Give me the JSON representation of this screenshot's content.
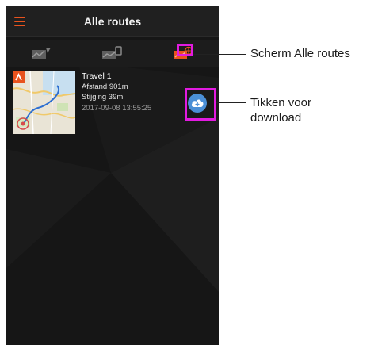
{
  "app": {
    "title": "Alle routes"
  },
  "tabs": [
    {
      "icon": "route-chart-icon",
      "active": false
    },
    {
      "icon": "route-device-icon",
      "active": false
    },
    {
      "icon": "route-online-icon",
      "active": true
    }
  ],
  "route": {
    "name": "Travel 1",
    "distance": "Afstand  901m",
    "climb": "Stijging  39m",
    "date": "2017-09-08 13:55:25"
  },
  "annotations": {
    "screen_label": "Scherm Alle routes",
    "download_line1": "Tikken voor",
    "download_line2": "download"
  },
  "colors": {
    "accent": "#e8531e",
    "highlight": "#e21be0",
    "download": "#4b8fd6"
  }
}
